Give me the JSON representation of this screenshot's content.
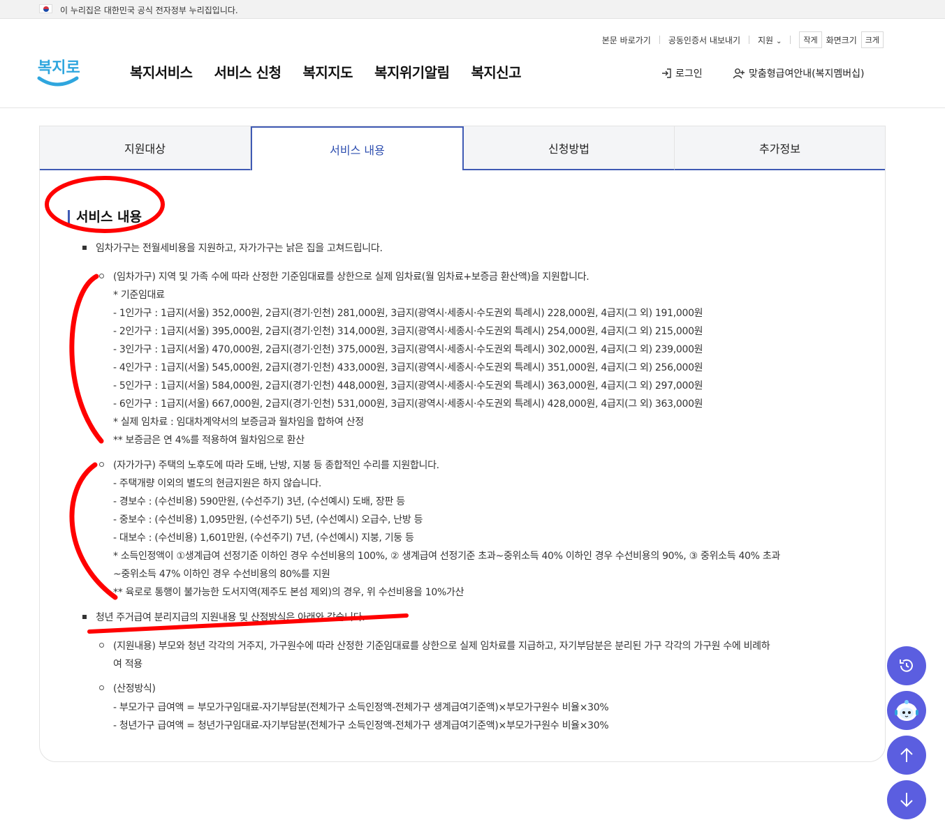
{
  "gov_banner": {
    "text": "이 누리집은 대한민국 공식 전자정부 누리집입니다."
  },
  "utility": {
    "skip": "본문 바로가기",
    "cert": "공동인증서 내보내기",
    "support": "지원",
    "smaller": "작게",
    "screen_size": "화면크기",
    "larger": "크게"
  },
  "logo": {
    "text": "복지로",
    "color": "#2fa6de"
  },
  "gnb": {
    "items": [
      "복지서비스",
      "서비스 신청",
      "복지지도",
      "복지위기알림",
      "복지신고"
    ]
  },
  "header_actions": {
    "login": "로그인",
    "member": "맞춤형급여안내(복지멤버십)"
  },
  "tabs": [
    {
      "label": "지원대상",
      "active": false
    },
    {
      "label": "서비스 내용",
      "active": true
    },
    {
      "label": "신청방법",
      "active": false
    },
    {
      "label": "추가정보",
      "active": false
    }
  ],
  "section_title": "서비스 내용",
  "content": {
    "b1": "임차가구는 전월세비용을 지원하고, 자가가구는 낡은 집을 고쳐드립니다.",
    "rent": [
      "(임차가구) 지역 및 가족 수에 따라 산정한 기준임대료를 상한으로 실제 임차료(월 임차료+보증금 환산액)을 지원합니다.",
      "* 기준임대료",
      "- 1인가구 : 1급지(서울) 352,000원, 2급지(경기·인천) 281,000원, 3급지(광역시·세종시·수도권외 특례시) 228,000원, 4급지(그 외) 191,000원",
      "- 2인가구 : 1급지(서울) 395,000원, 2급지(경기·인천) 314,000원, 3급지(광역시·세종시·수도권외 특례시) 254,000원, 4급지(그 외) 215,000원",
      "- 3인가구 : 1급지(서울) 470,000원, 2급지(경기·인천) 375,000원, 3급지(광역시·세종시·수도권외 특례시) 302,000원, 4급지(그 외) 239,000원",
      "- 4인가구 : 1급지(서울) 545,000원, 2급지(경기·인천) 433,000원, 3급지(광역시·세종시·수도권외 특례시) 351,000원, 4급지(그 외) 256,000원",
      "- 5인가구 : 1급지(서울) 584,000원, 2급지(경기·인천) 448,000원, 3급지(광역시·세종시·수도권외 특례시) 363,000원, 4급지(그 외) 297,000원",
      "- 6인가구 : 1급지(서울) 667,000원, 2급지(경기·인천) 531,000원, 3급지(광역시·세종시·수도권외 특례시) 428,000원, 4급지(그 외) 363,000원",
      "* 실제 임차료 : 임대차계약서의 보증금과 월차임을 합하여 산정",
      "** 보증금은 연 4%를 적용하여 월차임으로 환산"
    ],
    "own": [
      "(자가가구) 주택의 노후도에 따라 도배, 난방, 지붕 등 종합적인 수리를 지원합니다.",
      "- 주택개량 이외의 별도의 현금지원은 하지 않습니다.",
      "- 경보수 : (수선비용) 590만원, (수선주기) 3년, (수선예시) 도배, 장판 등",
      "- 중보수 : (수선비용) 1,095만원, (수선주기) 5년, (수선예시) 오급수, 난방 등",
      "- 대보수 : (수선비용) 1,601만원, (수선주기) 7년, (수선예시) 지붕, 기둥 등",
      "* 소득인정액이 ①생계급여 선정기준 이하인 경우 수선비용의 100%, ② 생계급여 선정기준 초과~중위소득 40% 이하인 경우 수선비용의 90%, ③ 중위소득 40% 초과",
      "~중위소득 47% 이하인 경우 수선비용의 80%를 지원",
      "** 육로로 통행이 불가능한 도서지역(제주도 본섬 제외)의 경우, 위 수선비용을 10%가산"
    ],
    "b2": "청년 주거급여 분리지급의 지원내용 및 산정방식은 아래와 같습니다.",
    "youth_support": [
      "(지원내용) 부모와 청년 각각의 거주지, 가구원수에 따라 산정한 기준임대료를 상한으로 실제 임차료를 지급하고, 자기부담분은 분리된 가구 각각의 가구원 수에 비례하",
      "여 적용"
    ],
    "youth_calc": [
      "(산정방식)",
      "- 부모가구 급여액 = 부모가구임대료-자기부담분(전체가구 소득인정액-전체가구 생계급여기준액)×부모가구원수 비율×30%",
      "- 청년가구 급여액 = 청년가구임대료-자기부담분(전체가구 소득인정액-전체가구 생계급여기준액)×부모가구원수 비율×30%"
    ]
  },
  "floating": {
    "history_icon": "history-icon",
    "chatbot_icon": "chatbot-icon",
    "up_icon": "arrow-up-icon",
    "down_icon": "arrow-down-icon",
    "color": "#5b5ee0"
  },
  "colors": {
    "accent": "#3f5ab4",
    "annotation": "#ff0000"
  }
}
